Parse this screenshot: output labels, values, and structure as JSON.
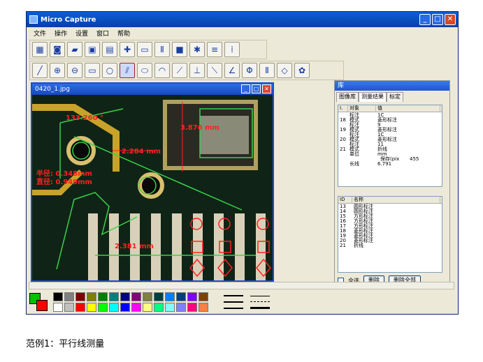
{
  "window": {
    "title": "Micro Capture"
  },
  "menu": [
    "文件",
    "操作",
    "设置",
    "窗口",
    "帮助"
  ],
  "child": {
    "title": "0420_1.jpg"
  },
  "measurements": {
    "angle": "133.260 °",
    "dist1": "2.284 mm",
    "dist2": "3.876 mm",
    "radius": "半径: 0.348mm",
    "diameter": "直径: 0.949mm",
    "dist3": "2.381 mm"
  },
  "panel": {
    "title": "库",
    "tabs": [
      "图像库",
      "测量结果",
      "标定"
    ],
    "table1_headers": [
      "I.",
      "对象",
      "值"
    ],
    "table1_rows": [
      [
        "",
        "标注",
        "1C"
      ],
      [
        "18",
        "模式",
        "菱形标注"
      ],
      [
        "",
        "标注",
        "9"
      ],
      [
        "19",
        "模式",
        "菱形标注"
      ],
      [
        "",
        "标注",
        "1C"
      ],
      [
        "20",
        "模式",
        "菱形标注"
      ],
      [
        "",
        "标注",
        "11"
      ],
      [
        "21",
        "模式",
        "折线"
      ],
      [
        "",
        "单位",
        "mm"
      ],
      [
        "",
        "长线",
        "6.791"
      ]
    ],
    "table1_extra": [
      "保存(pix",
      "455"
    ],
    "table2_headers": [
      "ID",
      "名称"
    ],
    "table2_rows": [
      [
        "13",
        "圆形标注"
      ],
      [
        "14",
        "圆形标注"
      ],
      [
        "15",
        "方形标注"
      ],
      [
        "16",
        "方形标注"
      ],
      [
        "17",
        "方形标注"
      ],
      [
        "18",
        "菱形标注"
      ],
      [
        "19",
        "菱形标注"
      ],
      [
        "20",
        "菱形标注"
      ],
      [
        "21",
        "折线"
      ]
    ],
    "checkbox_label": "全选",
    "delete_label": "删除",
    "delete_all_label": "删除全部"
  },
  "caption": "范例1：平行线测量",
  "colors": {
    "palette_top": [
      "#000000",
      "#808080",
      "#800000",
      "#808000",
      "#008000",
      "#008080",
      "#000080",
      "#800080",
      "#808040",
      "#004040",
      "#0080ff",
      "#004080",
      "#8000ff",
      "#804000"
    ],
    "palette_bottom": [
      "#ffffff",
      "#c0c0c0",
      "#ff0000",
      "#ffff00",
      "#00ff00",
      "#00ffff",
      "#0000ff",
      "#ff00ff",
      "#ffff80",
      "#00ff80",
      "#80ffff",
      "#8080ff",
      "#ff0080",
      "#ff8040"
    ]
  }
}
